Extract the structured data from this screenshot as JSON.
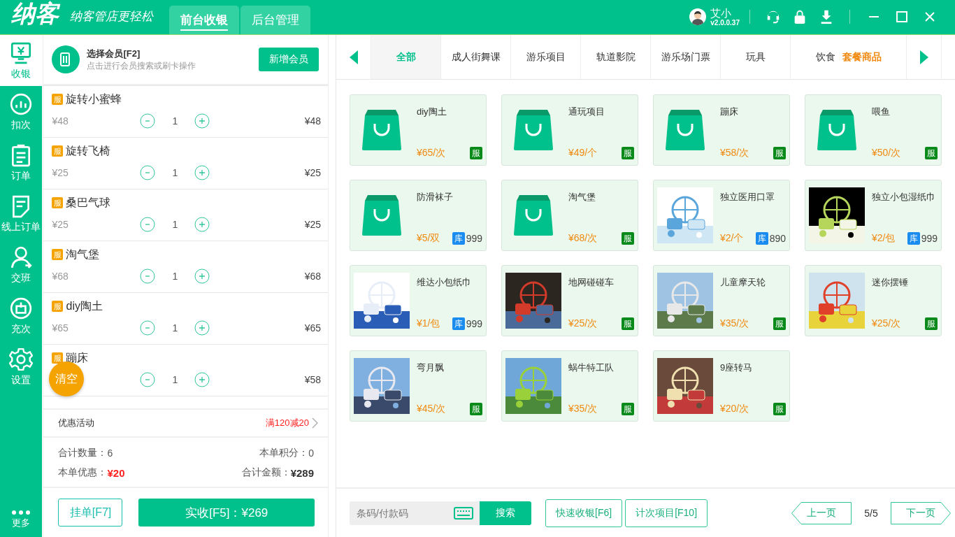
{
  "header": {
    "logo": "纳客",
    "slogan": "纳客管店更轻松",
    "tabs": [
      {
        "label": "前台收银",
        "selected": true
      },
      {
        "label": "后台管理",
        "selected": false
      }
    ],
    "user": {
      "name": "艾小",
      "version": "v2.0.0.37"
    }
  },
  "nav": [
    {
      "label": "收银",
      "selected": true
    },
    {
      "label": "扣次",
      "selected": false
    },
    {
      "label": "订单",
      "selected": false
    },
    {
      "label": "线上订单",
      "selected": false
    },
    {
      "label": "交班",
      "selected": false
    },
    {
      "label": "充次",
      "selected": false
    },
    {
      "label": "设置",
      "selected": false
    }
  ],
  "nav_more": "更多",
  "member": {
    "title": "选择会员[F2]",
    "hint": "点击进行会员搜索或刷卡操作",
    "button": "新增会员"
  },
  "cart": [
    {
      "tag": "服",
      "name": "旋转小蜜蜂",
      "unit_price": "¥48",
      "qty": "1",
      "total": "¥48"
    },
    {
      "tag": "服",
      "name": "旋转飞椅",
      "unit_price": "¥25",
      "qty": "1",
      "total": "¥25"
    },
    {
      "tag": "服",
      "name": "桑巴气球",
      "unit_price": "¥25",
      "qty": "1",
      "total": "¥25"
    },
    {
      "tag": "服",
      "name": "淘气堡",
      "unit_price": "¥68",
      "qty": "1",
      "total": "¥68"
    },
    {
      "tag": "服",
      "name": "diy陶土",
      "unit_price": "¥65",
      "qty": "1",
      "total": "¥65"
    },
    {
      "tag": "服",
      "name": "蹦床",
      "qty": "1",
      "total": "¥58"
    }
  ],
  "clear_button": "清空",
  "promo": {
    "label": "优惠活动",
    "value": "满120减20"
  },
  "totals": {
    "count_label": "合计数量：",
    "count": "6",
    "points_label": "本单积分：",
    "points": "0",
    "discount_label": "本单优惠：",
    "discount": "¥20",
    "amount_label": "合计金额：",
    "amount": "¥289"
  },
  "hold_button": "挂单[F7]",
  "pay_button": "实收[F5]：¥269",
  "categories": [
    {
      "label": "全部",
      "selected": true
    },
    {
      "label": "成人街舞课",
      "selected": false
    },
    {
      "label": "游乐项目",
      "selected": false
    },
    {
      "label": "轨道影院",
      "selected": false
    },
    {
      "label": "游乐场门票",
      "selected": false
    },
    {
      "label": "玩具",
      "selected": false
    },
    {
      "label": "饮食",
      "selected": false
    }
  ],
  "package_tab": "套餐商品",
  "products": [
    {
      "name": "diy陶土",
      "price": "¥65/次",
      "kind": "bag",
      "tag": "服"
    },
    {
      "name": "通玩项目",
      "price": "¥49/个",
      "kind": "bag",
      "tag": "服"
    },
    {
      "name": "蹦床",
      "price": "¥58/次",
      "kind": "bag",
      "tag": "服"
    },
    {
      "name": "喂鱼",
      "price": "¥50/次",
      "kind": "bag",
      "tag": "服"
    },
    {
      "name": "防滑袜子",
      "price": "¥5/双",
      "kind": "bag",
      "tag": "库",
      "stock": "999"
    },
    {
      "name": "淘气堡",
      "price": "¥68/次",
      "kind": "bag",
      "tag": "服"
    },
    {
      "name": "独立医用口罩",
      "price": "¥2/个",
      "kind": "picture",
      "tag": "库",
      "stock": "890"
    },
    {
      "name": "独立小包湿纸巾",
      "price": "¥2/包",
      "kind": "picture",
      "tag": "库",
      "stock": "999"
    },
    {
      "name": "维达小包纸巾",
      "price": "¥1/包",
      "kind": "picture",
      "tag": "库",
      "stock": "999"
    },
    {
      "name": "地网碰碰车",
      "price": "¥25/次",
      "kind": "picture",
      "tag": "服"
    },
    {
      "name": "儿童摩天轮",
      "price": "¥35/次",
      "kind": "picture",
      "tag": "服"
    },
    {
      "name": "迷你摆锤",
      "price": "¥25/次",
      "kind": "picture",
      "tag": "服"
    },
    {
      "name": "弯月飘",
      "price": "¥45/次",
      "kind": "picture",
      "tag": "服"
    },
    {
      "name": "蜗牛特工队",
      "price": "¥35/次",
      "kind": "picture",
      "tag": "服"
    },
    {
      "name": "9座转马",
      "price": "¥20/次",
      "kind": "picture",
      "tag": "服"
    }
  ],
  "search": {
    "placeholder": "条码/付款码",
    "button": "搜索"
  },
  "quick_buttons": [
    "快速收银[F6]",
    "计次项目[F10]"
  ],
  "pager": {
    "prev": "上一页",
    "page": "5/5",
    "next": "下一页"
  }
}
